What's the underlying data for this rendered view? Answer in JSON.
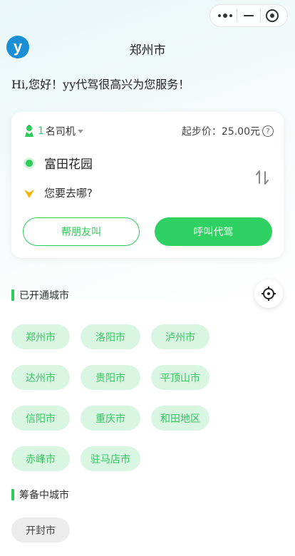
{
  "header": {
    "logo_text": "y",
    "title": "郑州市"
  },
  "greeting": "Hi,您好！yy代驾很高兴为您服务！",
  "order_card": {
    "driver_count": "1",
    "driver_unit": "名司机",
    "base_price_label": "起步价：",
    "base_price_value": "25.00元",
    "help_symbol": "?",
    "from_location": "富田花园",
    "to_placeholder": "您要去哪?",
    "friend_button": "帮朋友叫",
    "call_button": "呼叫代驾"
  },
  "opened_cities": {
    "title": "已开通城市",
    "items": [
      "郑州市",
      "洛阳市",
      "泸州市",
      "达州市",
      "贵阳市",
      "平顶山市",
      "信阳市",
      "重庆市",
      "和田地区",
      "赤峰市",
      "驻马店市"
    ]
  },
  "preparing_cities": {
    "title": "筹备中城市",
    "items": [
      "开封市"
    ]
  },
  "colors": {
    "accent_green": "#2ed162",
    "chip_bg": "#d9f6e2",
    "logo_blue": "#1b8fd6",
    "destination_marker": "#f5b400"
  },
  "icons": [
    "more-dots-icon",
    "minimize-icon",
    "close-target-icon",
    "driver-icon",
    "help-icon",
    "start-dot-icon",
    "destination-marker-icon",
    "swap-icon",
    "locate-icon"
  ]
}
